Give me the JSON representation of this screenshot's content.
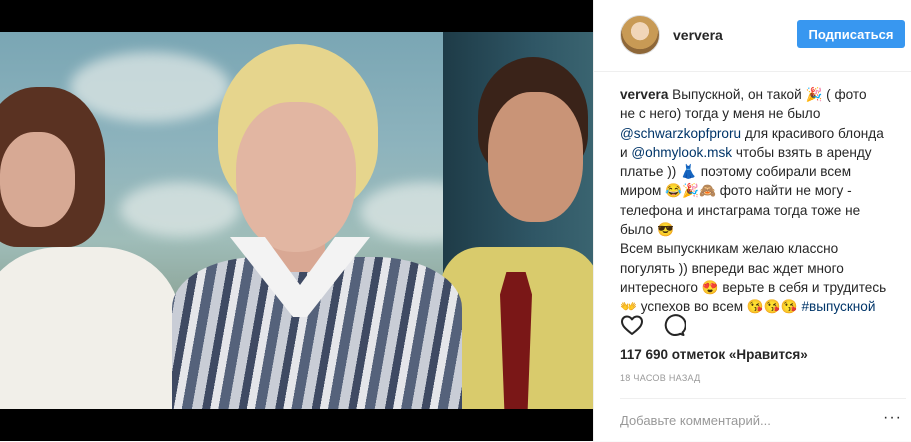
{
  "post": {
    "username": "ververa",
    "follow_label": "Подписаться",
    "caption_username": "ververa",
    "caption_lines": [
      " Выпускной, он такой 🎉 ( фото",
      "не с него) тогда у меня не было",
      "",
      " для красивого блонда",
      "и ",
      " чтобы взять в аренду",
      "платье )) 👗 поэтому собирали всем",
      "миром 😂🎉🙈 фото найти не могу -",
      "телефона и инстаграма тогда тоже не",
      "было 😎",
      "Всем выпускникам желаю классно",
      "погулять )) впереди вас ждет много",
      "интересного 😍 верьте в себя и трудитесь",
      "👐 успехов во всем 😘😘😘 "
    ],
    "mention_1": "@schwarzkopfproru",
    "mention_2": "@ohmylook.msk",
    "hashtag": "#выпускной",
    "likes_text": "117 690 отметок «Нравится»",
    "time_text": "18 ЧАСОВ НАЗАД",
    "comment_placeholder": "Добавьте комментарий...",
    "more_label": "···"
  },
  "icons": {
    "like": "heart-outline-icon",
    "comment": "speech-bubble-icon"
  },
  "colors": {
    "follow_button": "#3897f0",
    "link": "#003569",
    "muted": "#999999"
  }
}
